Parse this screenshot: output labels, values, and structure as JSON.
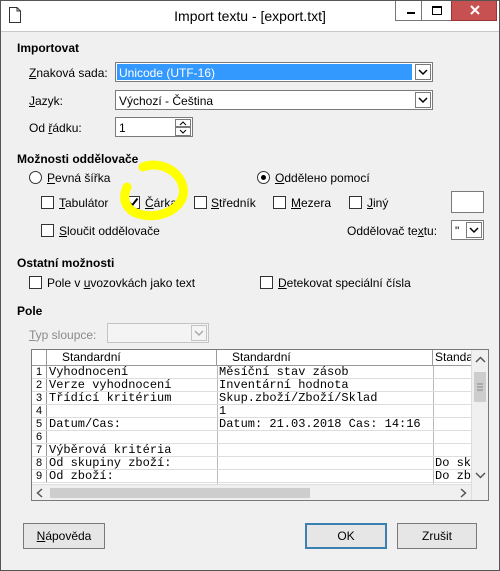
{
  "window": {
    "title": "Import textu - [export.txt]"
  },
  "import": {
    "heading": "Importovat",
    "charset_label": "Znaková sada:",
    "charset_value": "Unicode (UTF-16)",
    "language_label": "Jazyk:",
    "language_value": "Výchozí - Čeština",
    "from_row_label": "Od řádku:",
    "from_row_value": "1"
  },
  "separator": {
    "heading": "Možnosti oddělovače",
    "fixed_width": "Pevná šířka",
    "separated_by": "Odděleno pomocí",
    "tab": "Tabulátor",
    "comma": "Čárka",
    "semicolon": "Středník",
    "space": "Mezera",
    "other": "Jiný",
    "merge": "Sloučit oddělovače",
    "text_delim_label": "Oddělovač textu:",
    "text_delim_value": "\""
  },
  "other_options": {
    "heading": "Ostatní možnosti",
    "quoted_as_text": "Pole v uvozovkách jako text",
    "detect_special": "Detekovat speciální čísla"
  },
  "fields": {
    "heading": "Pole",
    "column_type_label": "Typ sloupce:"
  },
  "grid": {
    "headers": [
      "Standardní",
      "Standardní",
      "Standardní"
    ],
    "rows": [
      {
        "n": "1",
        "a": "Vyhodnocení",
        "b": "Měsíční stav zásob",
        "c": ""
      },
      {
        "n": "2",
        "a": "Verze vyhodnocení",
        "b": "Inventární hodnota",
        "c": ""
      },
      {
        "n": "3",
        "a": "Třídící kritérium",
        "b": "Skup.zboží/Zboží/Sklad",
        "c": ""
      },
      {
        "n": "4",
        "a": "",
        "b": "1",
        "c": ""
      },
      {
        "n": "5",
        "a": "Datum/Čas:",
        "b": "Datum: 21.03.2018   Čas: 14:16",
        "c": ""
      },
      {
        "n": "6",
        "a": "",
        "b": "",
        "c": ""
      },
      {
        "n": "7",
        "a": "Výběrová kritéria",
        "b": "",
        "c": ""
      },
      {
        "n": "8",
        "a": "Od skupiny zboží:",
        "b": "",
        "c": "Do skupiny zboží:"
      },
      {
        "n": "9",
        "a": "Od zboží:",
        "b": "",
        "c": "Do zboží:"
      }
    ]
  },
  "buttons": {
    "help": "Nápověda",
    "ok": "OK",
    "cancel": "Zrušit"
  },
  "colors": {
    "highlight": "#3399ff",
    "annotation": "#ffff00"
  }
}
